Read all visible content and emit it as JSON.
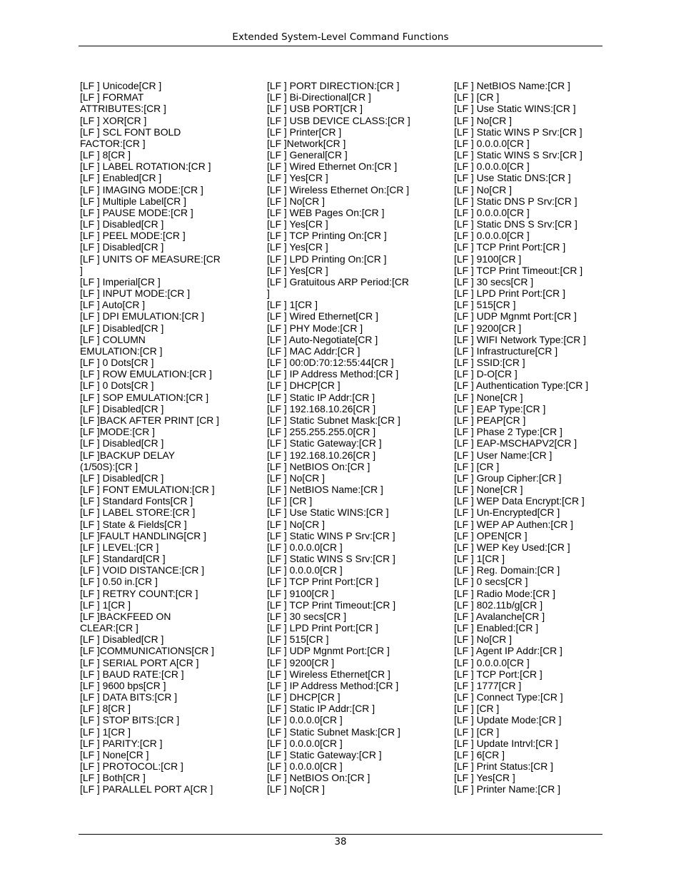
{
  "header": {
    "title": "Extended System-Level Command Functions"
  },
  "footer": {
    "page_number": "38"
  },
  "columns": [
    [
      "[LF ] Unicode[CR ]",
      "[LF ] FORMAT",
      "ATTRIBUTES:[CR ]",
      "[LF ] XOR[CR ]",
      "[LF ] SCL FONT BOLD",
      "FACTOR:[CR ]",
      "[LF ] 8[CR ]",
      "[LF ] LABEL ROTATION:[CR ]",
      "[LF ] Enabled[CR ]",
      "[LF ] IMAGING MODE:[CR ]",
      "[LF ] Multiple Label[CR ]",
      "[LF ] PAUSE MODE:[CR ]",
      "[LF ] Disabled[CR ]",
      "[LF ] PEEL MODE:[CR ]",
      "[LF ] Disabled[CR ]",
      "[LF ] UNITS OF MEASURE:[CR",
      "]",
      "[LF ] Imperial[CR ]",
      "[LF ] INPUT MODE:[CR ]",
      "[LF ] Auto[CR ]",
      "[LF ] DPI EMULATION:[CR ]",
      "[LF ] Disabled[CR ]",
      "[LF ] COLUMN",
      "EMULATION:[CR ]",
      "[LF ] 0 Dots[CR ]",
      "[LF ] ROW EMULATION:[CR ]",
      "[LF ] 0 Dots[CR ]",
      "[LF ] SOP EMULATION:[CR ]",
      "[LF ] Disabled[CR ]",
      "[LF ]BACK AFTER PRINT [CR ]",
      "[LF ]MODE:[CR ]",
      "[LF ] Disabled[CR ]",
      "[LF ]BACKUP DELAY",
      "(1/50S):[CR ]",
      "[LF ] Disabled[CR ]",
      "[LF ] FONT EMULATION:[CR ]",
      "[LF ] Standard Fonts[CR ]",
      "[LF ] LABEL STORE:[CR ]",
      "[LF ] State & Fields[CR ]",
      "[LF ]FAULT HANDLING[CR ]",
      "[LF ] LEVEL:[CR ]",
      "[LF ] Standard[CR ]",
      "[LF ] VOID DISTANCE:[CR ]",
      "[LF ] 0.50 in.[CR ]",
      "[LF ] RETRY COUNT:[CR ]",
      "[LF ] 1[CR ]",
      "[LF ]BACKFEED ON",
      "CLEAR:[CR ]",
      "[LF ] Disabled[CR ]",
      "[LF ]COMMUNICATIONS[CR ]",
      "[LF ] SERIAL PORT A[CR ]",
      "[LF ] BAUD RATE:[CR ]",
      "[LF ] 9600 bps[CR ]",
      "[LF ] DATA BITS:[CR ]",
      "[LF ] 8[CR ]",
      "[LF ] STOP BITS:[CR ]",
      "[LF ] 1[CR ]",
      "[LF ] PARITY:[CR ]",
      "[LF ] None[CR ]",
      "[LF ] PROTOCOL:[CR ]",
      "[LF ] Both[CR ]",
      "[LF ] PARALLEL PORT A[CR ]"
    ],
    [
      "[LF ] PORT DIRECTION:[CR ]",
      "[LF ] Bi-Directional[CR ]",
      "[LF ] USB PORT[CR ]",
      "[LF ] USB DEVICE CLASS:[CR ]",
      "[LF ] Printer[CR ]",
      "[LF ]Network[CR ]",
      "[LF ] General[CR ]",
      "[LF ] Wired Ethernet On:[CR ]",
      "[LF ] Yes[CR ]",
      "[LF ] Wireless Ethernet On:[CR ]",
      "[LF ] No[CR ]",
      "[LF ] WEB Pages On:[CR ]",
      "[LF ] Yes[CR ]",
      "[LF ] TCP Printing On:[CR ]",
      "[LF ] Yes[CR ]",
      "[LF ] LPD Printing On:[CR ]",
      "[LF ] Yes[CR ]",
      "[LF ] Gratuitous ARP Period:[CR",
      "]",
      "[LF ] 1[CR ]",
      "[LF ] Wired Ethernet[CR ]",
      "[LF ] PHY Mode:[CR ]",
      "[LF ] Auto-Negotiate[CR ]",
      "[LF ] MAC Addr:[CR ]",
      "[LF ] 00:0D:70:12:55:44[CR ]",
      "[LF ] IP Address Method:[CR ]",
      "[LF ] DHCP[CR ]",
      "[LF ] Static IP Addr:[CR ]",
      "[LF ] 192.168.10.26[CR ]",
      "[LF ] Static Subnet Mask:[CR ]",
      "[LF ] 255.255.255.0[CR ]",
      "[LF ] Static Gateway:[CR ]",
      "[LF ] 192.168.10.26[CR ]",
      "[LF ] NetBIOS On:[CR ]",
      "[LF ] No[CR ]",
      "[LF ] NetBIOS Name:[CR ]",
      "[LF ] [CR ]",
      "[LF ] Use Static WINS:[CR ]",
      "[LF ] No[CR ]",
      "[LF ] Static WINS P Srv:[CR ]",
      "[LF ] 0.0.0.0[CR ]",
      "[LF ] Static WINS S Srv:[CR ]",
      "[LF ] 0.0.0.0[CR ]",
      "[LF ] TCP Print Port:[CR ]",
      "[LF ] 9100[CR ]",
      "[LF ] TCP Print Timeout:[CR ]",
      "[LF ] 30 secs[CR ]",
      "[LF ] LPD Print Port:[CR ]",
      "[LF ] 515[CR ]",
      "[LF ] UDP Mgnmt Port:[CR ]",
      "[LF ] 9200[CR ]",
      "[LF ] Wireless Ethernet[CR ]",
      "[LF ] IP Address Method:[CR ]",
      "[LF ] DHCP[CR ]",
      "[LF ] Static IP Addr:[CR ]",
      "[LF ] 0.0.0.0[CR ]",
      "[LF ] Static Subnet Mask:[CR ]",
      "[LF ] 0.0.0.0[CR ]",
      "[LF ] Static Gateway:[CR ]",
      "[LF ] 0.0.0.0[CR ]",
      "[LF ] NetBIOS On:[CR ]",
      "[LF ] No[CR ]"
    ],
    [
      "[LF ] NetBIOS Name:[CR ]",
      "[LF ] [CR ]",
      "[LF ] Use Static WINS:[CR ]",
      "[LF ] No[CR ]",
      "[LF ] Static WINS P Srv:[CR ]",
      "[LF ] 0.0.0.0[CR ]",
      "[LF ] Static WINS S Srv:[CR ]",
      "[LF ] 0.0.0.0[CR ]",
      "[LF ] Use Static DNS:[CR ]",
      "[LF ] No[CR ]",
      "[LF ] Static DNS P Srv:[CR ]",
      "[LF ] 0.0.0.0[CR ]",
      "[LF ] Static DNS S Srv:[CR ]",
      "[LF ] 0.0.0.0[CR ]",
      "[LF ] TCP Print Port:[CR ]",
      "[LF ] 9100[CR ]",
      "[LF ] TCP Print Timeout:[CR ]",
      "[LF ] 30 secs[CR ]",
      "[LF ] LPD Print Port:[CR ]",
      "[LF ] 515[CR ]",
      "[LF ] UDP Mgnmt Port:[CR ]",
      "[LF ] 9200[CR ]",
      "[LF ] WIFI Network Type:[CR ]",
      "[LF ] Infrastructure[CR ]",
      "[LF ] SSID:[CR ]",
      "[LF ] D-O[CR ]",
      "[LF ] Authentication Type:[CR ]",
      "[LF ] None[CR ]",
      "[LF ] EAP Type:[CR ]",
      "[LF ] PEAP[CR ]",
      "[LF ] Phase 2 Type:[CR ]",
      "[LF ] EAP-MSCHAPV2[CR ]",
      "[LF ] User Name:[CR ]",
      "[LF ] [CR ]",
      "[LF ] Group Cipher:[CR ]",
      "[LF ] None[CR ]",
      "[LF ] WEP Data Encrypt:[CR ]",
      "[LF ] Un-Encrypted[CR ]",
      "[LF ] WEP AP Authen:[CR ]",
      "[LF ] OPEN[CR ]",
      "[LF ] WEP Key Used:[CR ]",
      "[LF ] 1[CR ]",
      "[LF ] Reg. Domain:[CR ]",
      "[LF ] 0 secs[CR ]",
      "[LF ] Radio Mode:[CR ]",
      "[LF ] 802.11b/g[CR ]",
      "[LF ] Avalanche[CR ]",
      "[LF ] Enabled:[CR ]",
      "[LF ] No[CR ]",
      "[LF ] Agent IP Addr:[CR ]",
      "[LF ] 0.0.0.0[CR ]",
      "[LF ] TCP Port:[CR ]",
      "[LF ] 1777[CR ]",
      "[LF ] Connect Type:[CR ]",
      "[LF ] [CR ]",
      "[LF ] Update Mode:[CR ]",
      "[LF ] [CR ]",
      "[LF ] Update Intrvl:[CR ]",
      "[LF ] 6[CR ]",
      "[LF ] Print Status:[CR ]",
      "[LF ] Yes[CR ]",
      "[LF ] Printer Name:[CR ]"
    ]
  ]
}
